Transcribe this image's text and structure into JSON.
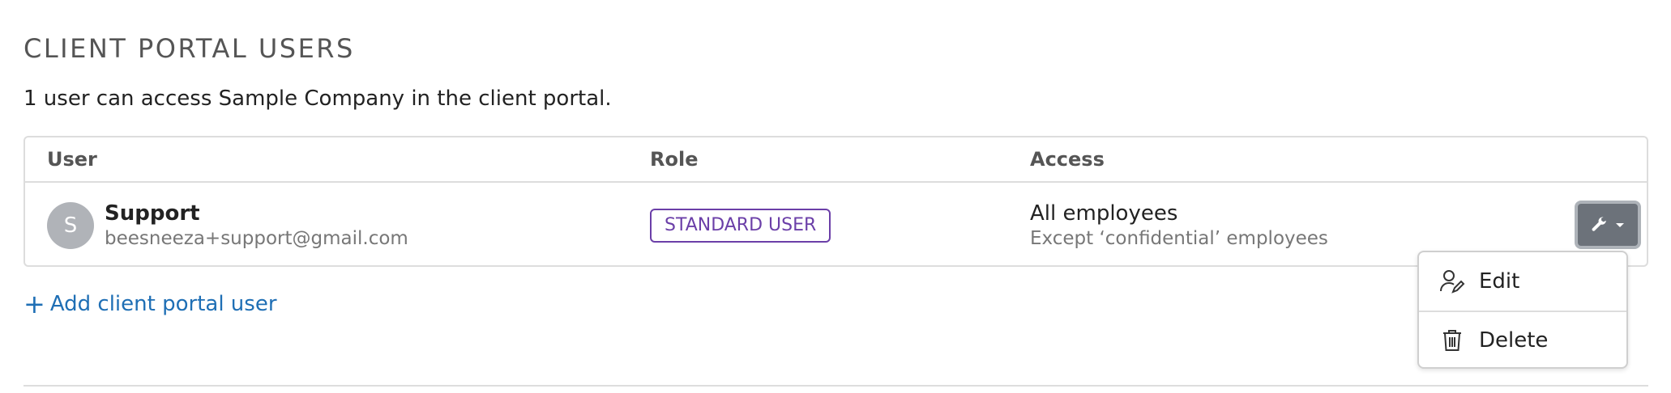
{
  "section": {
    "title": "CLIENT PORTAL USERS",
    "subtitle": "1 user can access Sample Company in the client portal."
  },
  "table": {
    "headers": {
      "user": "User",
      "role": "Role",
      "access": "Access"
    },
    "rows": [
      {
        "avatar_initial": "S",
        "name": "Support",
        "email": "beesneeza+support@gmail.com",
        "role": "STANDARD USER",
        "access_main": "All employees",
        "access_sub": "Except ‘confidential’ employees"
      }
    ]
  },
  "actions": {
    "button_icon": "wrench-icon",
    "menu": [
      {
        "label": "Edit",
        "icon": "user-edit-icon"
      },
      {
        "label": "Delete",
        "icon": "trash-icon"
      }
    ]
  },
  "add_user": {
    "label": "Add client portal user"
  },
  "colors": {
    "accent_link": "#1f6fb5",
    "role_badge": "#6b3fa8",
    "avatar_bg": "#b0b3b8",
    "action_button_bg": "#6c727a"
  }
}
